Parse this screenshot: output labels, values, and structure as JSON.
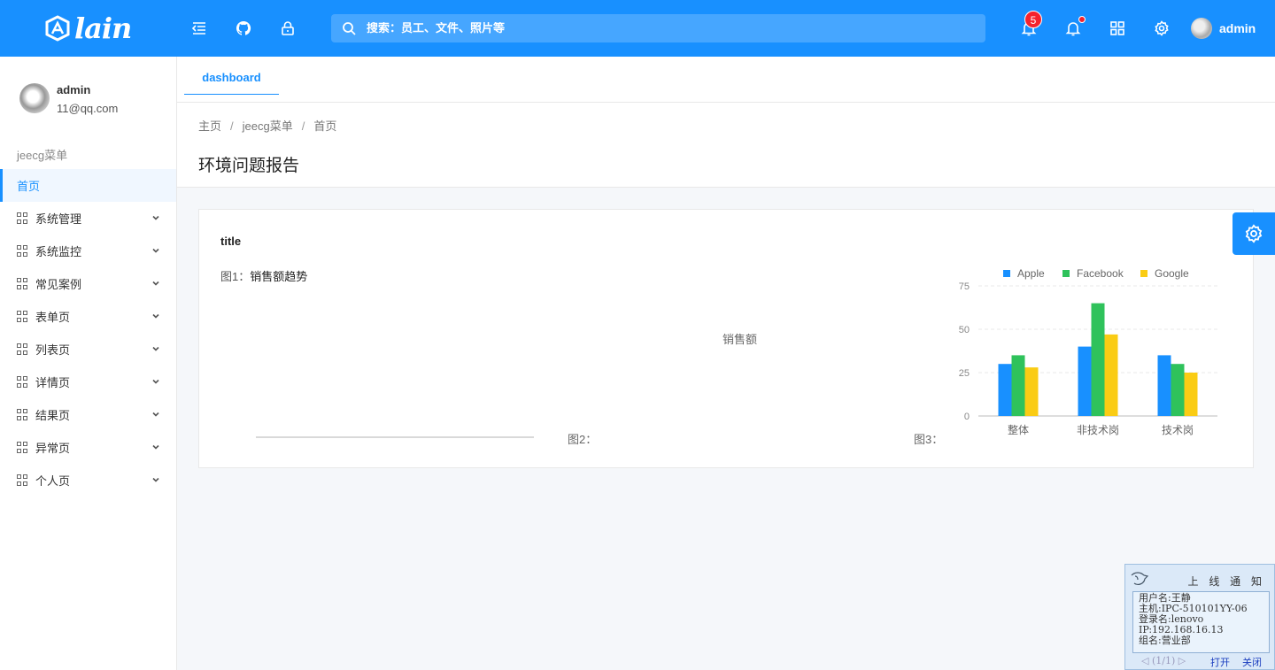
{
  "header": {
    "logo_text": "lain",
    "search_placeholder": "搜索：员工、文件、照片等",
    "notification_count": "5",
    "user_name": "admin",
    "icons": [
      "menu-fold-icon",
      "github-icon",
      "lock-icon",
      "search-icon",
      "bell-icon",
      "bell-dot-icon",
      "apps-icon",
      "setting-icon"
    ]
  },
  "sidebar": {
    "user_name": "admin",
    "user_email": "11@qq.com",
    "group_title": "jeecg菜单",
    "items": [
      {
        "label": "首页",
        "active": true
      },
      {
        "label": "系统管理"
      },
      {
        "label": "系统监控"
      },
      {
        "label": "常见案例"
      },
      {
        "label": "表单页"
      },
      {
        "label": "列表页"
      },
      {
        "label": "详情页"
      },
      {
        "label": "结果页"
      },
      {
        "label": "异常页"
      },
      {
        "label": "个人页"
      }
    ]
  },
  "tabs": [
    "dashboard"
  ],
  "breadcrumb": [
    "主页",
    "jeecg菜单",
    "首页"
  ],
  "page_title": "环境问题报告",
  "card": {
    "title": "title",
    "fig1_prefix": "图1：",
    "fig1_name": "销售额趋势",
    "center_label": "销售额",
    "fig2_label": "图2：",
    "fig3_label": "图3："
  },
  "chart_data": {
    "type": "bar",
    "categories": [
      "整体",
      "非技术岗",
      "技术岗"
    ],
    "series": [
      {
        "name": "Apple",
        "color": "#1890ff",
        "values": [
          30,
          40,
          35
        ]
      },
      {
        "name": "Facebook",
        "color": "#2fc25b",
        "values": [
          35,
          65,
          30
        ]
      },
      {
        "name": "Google",
        "color": "#facc14",
        "values": [
          28,
          47,
          25
        ]
      }
    ],
    "yticks": [
      0,
      25,
      50,
      75
    ],
    "ylim": [
      0,
      75
    ],
    "legend": "top",
    "grid": true
  },
  "notice": {
    "title": "上 线 通 知",
    "lines": [
      "用户名:王静",
      "主机:IPC-510101YY-06",
      "登录名:lenovo",
      "IP:192.168.16.13",
      "组名:营业部"
    ],
    "pager": "◁ (1/1) ▷",
    "open_label": "打开",
    "close_label": "关闭"
  }
}
